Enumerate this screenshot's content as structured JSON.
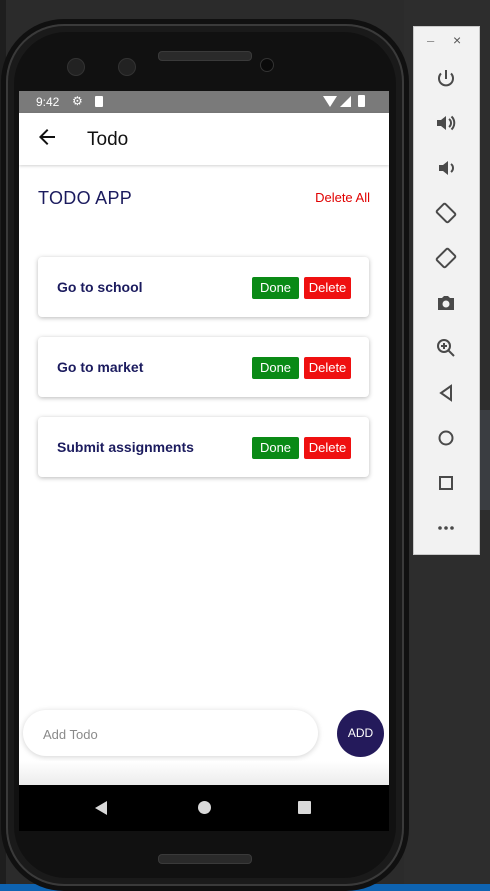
{
  "status_bar": {
    "time": "9:42"
  },
  "appbar": {
    "title": "Todo"
  },
  "app": {
    "header": "TODO APP",
    "delete_all": "Delete All"
  },
  "todos": [
    {
      "text": "Go to school",
      "done_label": "Done",
      "delete_label": "Delete"
    },
    {
      "text": "Go to market",
      "done_label": "Done",
      "delete_label": "Delete"
    },
    {
      "text": "Submit assignments",
      "done_label": "Done",
      "delete_label": "Delete"
    }
  ],
  "add": {
    "placeholder": "Add Todo",
    "button_label": "ADD"
  },
  "emulator": {
    "controls": [
      "power-icon",
      "volume-up-icon",
      "volume-down-icon",
      "rotate-left-icon",
      "rotate-right-icon",
      "camera-icon",
      "zoom-icon",
      "back-icon",
      "home-icon",
      "overview-icon",
      "more-icon"
    ],
    "window": {
      "minimize": "–",
      "close": "×"
    }
  },
  "colors": {
    "accent": "#241a5b",
    "done": "#0a8a16",
    "delete": "#ef1010",
    "text_dark": "#1b1b5e"
  }
}
